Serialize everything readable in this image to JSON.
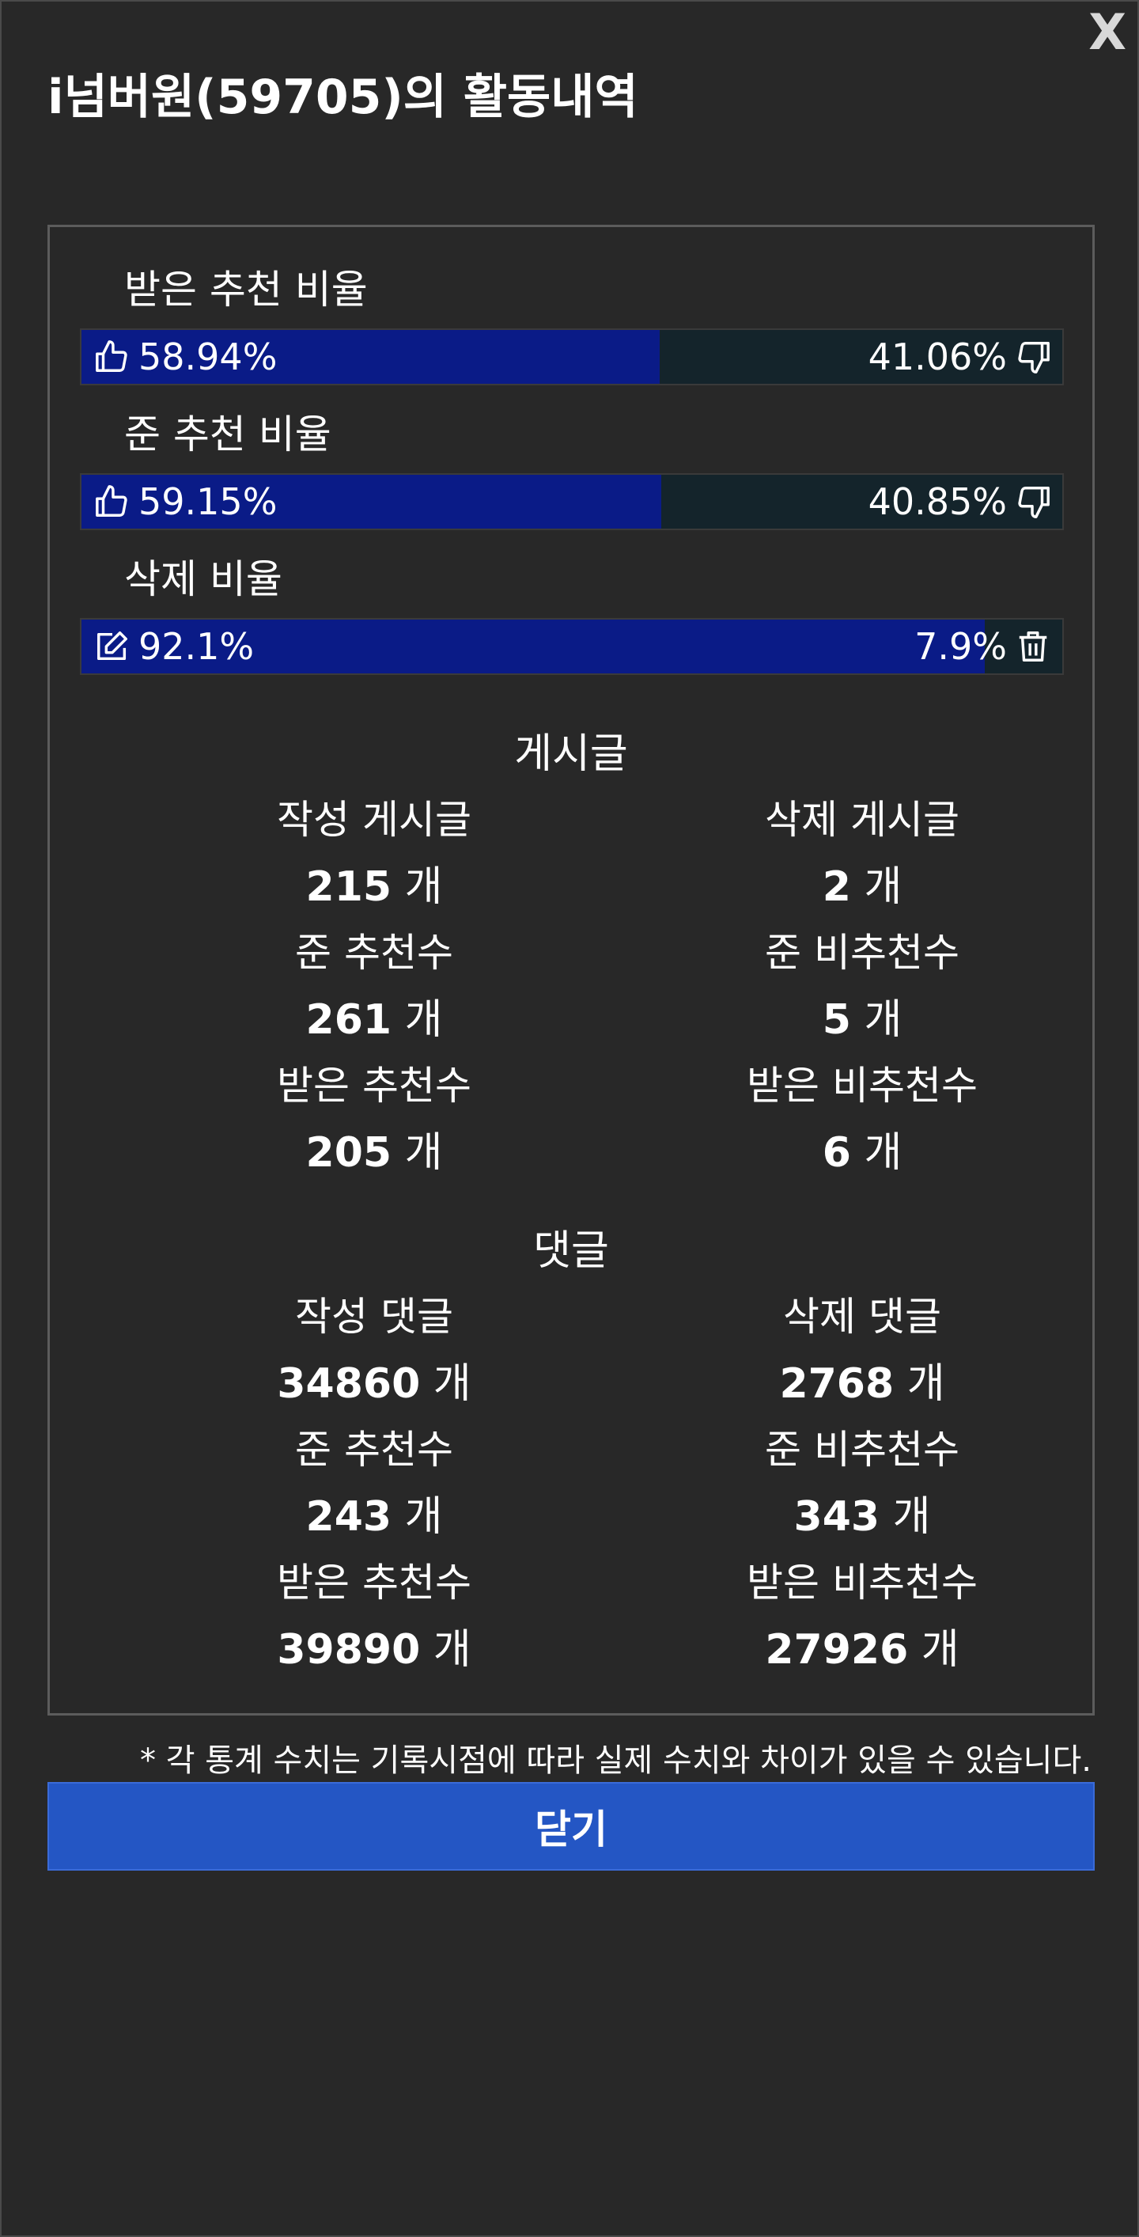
{
  "close_x": "X",
  "title": "i넘버원(59705)의 활동내역",
  "ratios": [
    {
      "label": "받은 추천 비율",
      "left_value": "58.94%",
      "right_value": "41.06%",
      "fill": 0.5894,
      "left_icon": "thumbs-up-icon",
      "right_icon": "thumbs-down-icon"
    },
    {
      "label": "준 추천 비율",
      "left_value": "59.15%",
      "right_value": "40.85%",
      "fill": 0.5915,
      "left_icon": "thumbs-up-icon",
      "right_icon": "thumbs-down-icon"
    },
    {
      "label": "삭제 비율",
      "left_value": "92.1%",
      "right_value": "7.9%",
      "fill": 0.921,
      "left_icon": "edit-icon",
      "right_icon": "trash-icon"
    }
  ],
  "posts": {
    "title": "게시글",
    "stats": [
      {
        "label": "작성 게시글",
        "value": "215",
        "unit": "개"
      },
      {
        "label": "삭제 게시글",
        "value": "2",
        "unit": "개"
      },
      {
        "label": "준 추천수",
        "value": "261",
        "unit": "개"
      },
      {
        "label": "준 비추천수",
        "value": "5",
        "unit": "개"
      },
      {
        "label": "받은 추천수",
        "value": "205",
        "unit": "개"
      },
      {
        "label": "받은 비추천수",
        "value": "6",
        "unit": "개"
      }
    ]
  },
  "comments": {
    "title": "댓글",
    "stats": [
      {
        "label": "작성 댓글",
        "value": "34860",
        "unit": "개"
      },
      {
        "label": "삭제 댓글",
        "value": "2768",
        "unit": "개"
      },
      {
        "label": "준 추천수",
        "value": "243",
        "unit": "개"
      },
      {
        "label": "준 비추천수",
        "value": "343",
        "unit": "개"
      },
      {
        "label": "받은 추천수",
        "value": "39890",
        "unit": "개"
      },
      {
        "label": "받은 비추천수",
        "value": "27926",
        "unit": "개"
      }
    ]
  },
  "disclaimer": "* 각 통계 수치는 기록시점에 따라 실제 수치와 차이가 있을 수 있습니다.",
  "close_button": "닫기",
  "colors": {
    "background": "#282828",
    "bar_fill": "#0a1b87",
    "bar_track": "#14242b",
    "button": "#2456c4"
  }
}
